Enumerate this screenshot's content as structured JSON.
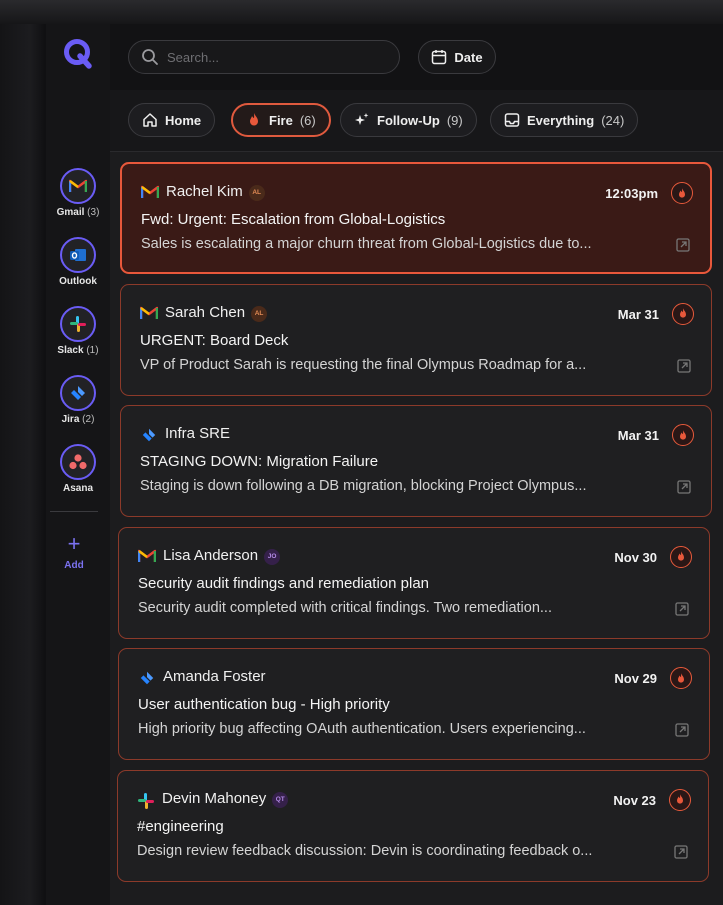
{
  "search": {
    "placeholder": "Search..."
  },
  "date_button": {
    "label": "Date"
  },
  "tabs": [
    {
      "label": "Home",
      "count": ""
    },
    {
      "label": "Fire",
      "count": "(6)"
    },
    {
      "label": "Follow-Up",
      "count": "(9)"
    },
    {
      "label": "Everything",
      "count": "(24)"
    }
  ],
  "apps": [
    {
      "name": "Gmail",
      "count": "(3)"
    },
    {
      "name": "Outlook",
      "count": ""
    },
    {
      "name": "Slack",
      "count": "(1)"
    },
    {
      "name": "Jira",
      "count": "(2)"
    },
    {
      "name": "Asana",
      "count": ""
    }
  ],
  "add_label": "Add",
  "messages": [
    {
      "source": "gmail",
      "sender": "Rachel Kim",
      "badge": "AL",
      "time": "12:03pm",
      "subject": "Fwd: Urgent: Escalation from Global-Logistics",
      "preview": "Sales is escalating a major churn threat from Global-Logistics due to..."
    },
    {
      "source": "gmail",
      "sender": "Sarah Chen",
      "badge": "AL",
      "time": "Mar 31",
      "subject": "URGENT: Board Deck",
      "preview": "VP of Product Sarah is requesting the final Olympus Roadmap for a..."
    },
    {
      "source": "jira",
      "sender": "Infra SRE",
      "badge": "",
      "time": "Mar 31",
      "subject": "STAGING DOWN: Migration Failure",
      "preview": "Staging is down following a DB migration, blocking Project Olympus..."
    },
    {
      "source": "gmail",
      "sender": "Lisa Anderson",
      "badge": "JO",
      "time": "Nov 30",
      "subject": "Security audit findings and remediation plan",
      "preview": "Security audit completed with critical findings. Two remediation..."
    },
    {
      "source": "jira",
      "sender": "Amanda Foster",
      "badge": "",
      "time": "Nov 29",
      "subject": "User authentication bug - High priority",
      "preview": "High priority bug affecting OAuth authentication. Users experiencing..."
    },
    {
      "source": "slack",
      "sender": "Devin Mahoney",
      "badge": "QT",
      "time": "Nov 23",
      "subject": "#engineering",
      "preview": "Design review feedback discussion: Devin is coordinating feedback o..."
    }
  ],
  "colors": {
    "accent": "#6a5cf5",
    "fire": "#e8583b",
    "background": "#1c1c1e"
  }
}
